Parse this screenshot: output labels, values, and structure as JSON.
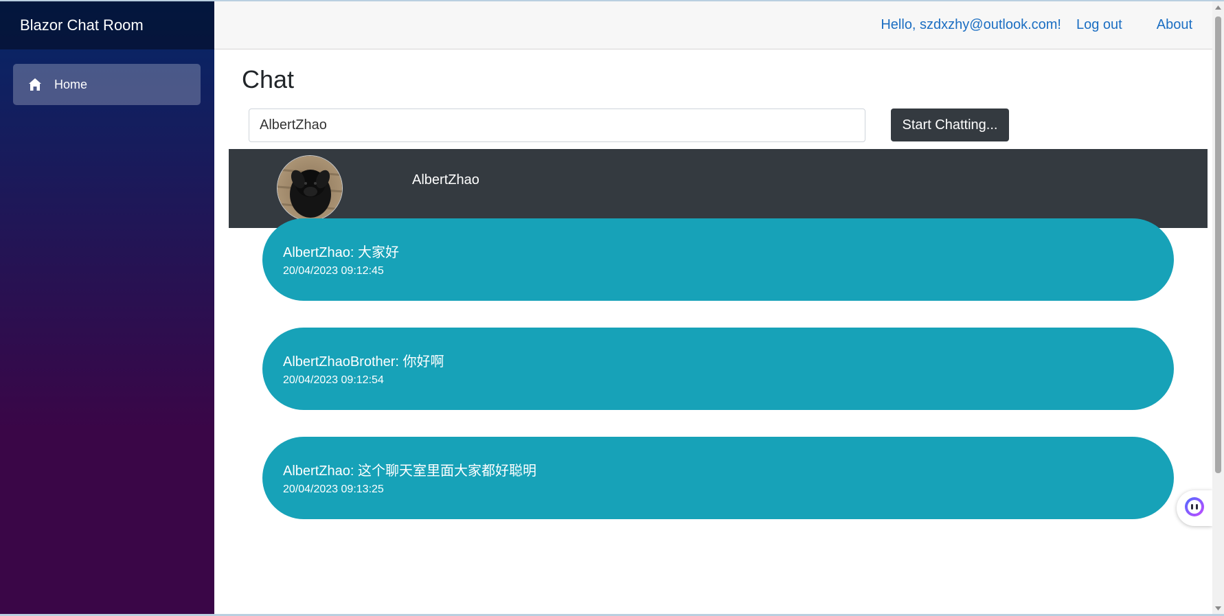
{
  "sidebar": {
    "brand": "Blazor Chat Room",
    "items": [
      {
        "label": "Home",
        "icon": "home-icon"
      }
    ]
  },
  "top_row": {
    "greeting": "Hello, szdxzhy@outlook.com!",
    "logout": "Log out",
    "about": "About"
  },
  "main": {
    "title": "Chat",
    "username_value": "AlbertZhao",
    "start_button": "Start Chatting...",
    "chat_header_name": "AlbertZhao",
    "messages": [
      {
        "text": "AlbertZhao: 大家好",
        "time": "20/04/2023 09:12:45"
      },
      {
        "text": "AlbertZhaoBrother: 你好啊",
        "time": "20/04/2023 09:12:54"
      },
      {
        "text": "AlbertZhao: 这个聊天室里面大家都好聪明",
        "time": "20/04/2023 09:13:25"
      }
    ]
  },
  "colors": {
    "sidebar_top": "#052767",
    "sidebar_bottom": "#3a0647",
    "bubble": "#17a2b8",
    "header_dark": "#343a40",
    "link": "#1b6ec2"
  }
}
